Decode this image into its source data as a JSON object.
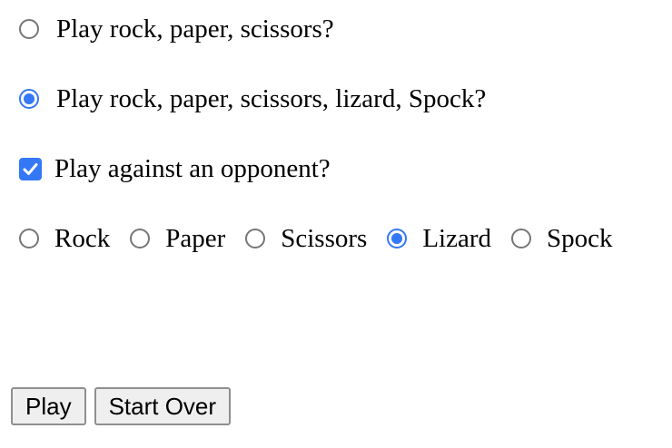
{
  "game_mode_options": [
    {
      "label": "Play rock, paper, scissors?",
      "checked": false
    },
    {
      "label": "Play rock, paper, scissors, lizard, Spock?",
      "checked": true
    }
  ],
  "opponent_option": {
    "label": "Play against an opponent?",
    "checked": true
  },
  "choices": [
    {
      "label": "Rock",
      "checked": false
    },
    {
      "label": "Paper",
      "checked": false
    },
    {
      "label": "Scissors",
      "checked": false
    },
    {
      "label": "Lizard",
      "checked": true
    },
    {
      "label": "Spock",
      "checked": false
    }
  ],
  "buttons": {
    "play_label": "Play",
    "start_over_label": "Start Over"
  },
  "colors": {
    "accent": "#3478f6",
    "radio_border": "#767676",
    "button_bg": "#efefef",
    "button_border": "#8f8f8f"
  }
}
